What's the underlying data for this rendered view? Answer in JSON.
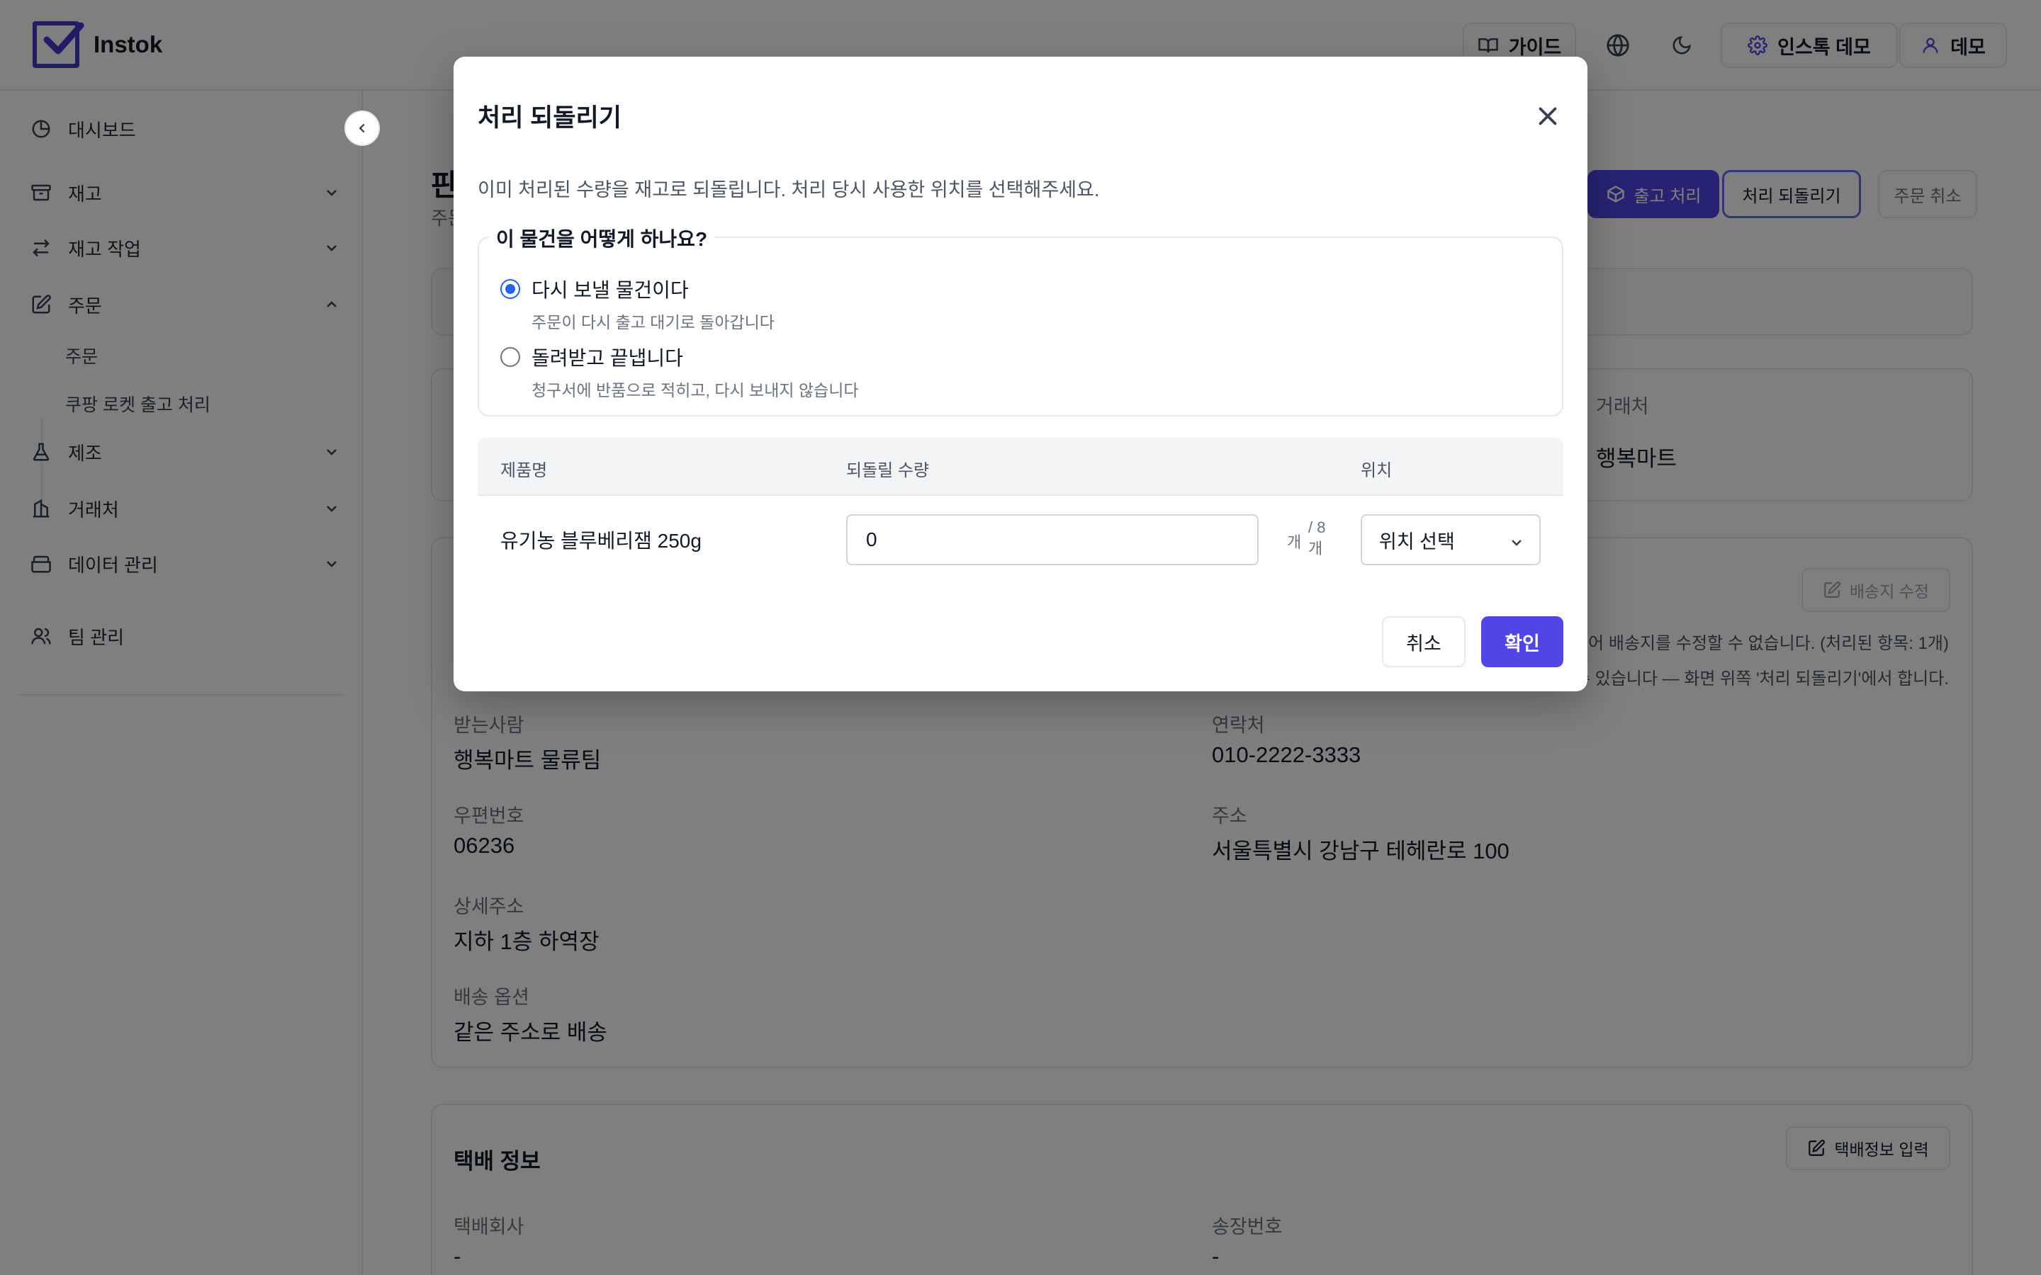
{
  "app": {
    "name": "Instok"
  },
  "topbar": {
    "guide_label": "가이드",
    "workspace_label": "인스톡 데모",
    "user_label": "데모"
  },
  "sidebar": {
    "items": [
      {
        "label": "대시보드"
      },
      {
        "label": "재고"
      },
      {
        "label": "재고 작업"
      },
      {
        "label": "주문"
      },
      {
        "label": "제조"
      },
      {
        "label": "거래처"
      },
      {
        "label": "데이터 관리"
      },
      {
        "label": "팀 관리"
      }
    ],
    "order_subitems": [
      {
        "label": "주문"
      },
      {
        "label": "쿠팡 로켓 출고 처리"
      }
    ]
  },
  "page": {
    "title_fragment": "판",
    "subtitle_fragment": "주문",
    "actions": {
      "ship_label": "출고 처리",
      "revert_label": "처리 되돌리기",
      "cancel_order_label": "주문 취소"
    },
    "partner": {
      "label": "거래처",
      "value": "행복마트"
    },
    "shipping": {
      "edit_label": "배송지 수정",
      "note_line1": "이 있어 배송지를 수정할 수 없습니다. (처리된 항목: 1개)",
      "note_line2": "할 수 있습니다 — 화면 위쪽 '처리 되돌리기'에서 합니다.",
      "recipient_label": "받는사람",
      "recipient_value": "행복마트 물류팀",
      "phone_label": "연락처",
      "phone_value": "010-2222-3333",
      "zip_label": "우편번호",
      "zip_value": "06236",
      "address_label": "주소",
      "address_value": "서울특별시 강남구 테헤란로 100",
      "detail_label": "상세주소",
      "detail_value": "지하 1층 하역장",
      "option_label": "배송 옵션",
      "option_value": "같은 주소로 배송"
    },
    "courier": {
      "title": "택배 정보",
      "input_label": "택배정보 입력",
      "company_label": "택배회사",
      "company_value": "-",
      "tracking_label": "송장번호",
      "tracking_value": "-"
    }
  },
  "modal": {
    "title": "처리 되돌리기",
    "description": "이미 처리된 수량을 재고로 되돌립니다. 처리 당시 사용한 위치를 선택해주세요.",
    "question": "이 물건을 어떻게 하나요?",
    "options": [
      {
        "label": "다시 보낼 물건이다",
        "sub": "주문이 다시 출고 대기로 돌아갑니다",
        "selected": true
      },
      {
        "label": "돌려받고 끝냅니다",
        "sub": "청구서에 반품으로 적히고, 다시 보내지 않습니다",
        "selected": false
      }
    ],
    "table": {
      "headers": {
        "product": "제품명",
        "qty": "되돌릴 수량",
        "location": "위치"
      },
      "row": {
        "product": "유기농 블루베리잼 250g",
        "qty_value": "0",
        "unit": "개",
        "max_line1": "/ 8",
        "max_line2": "개",
        "location_placeholder": "위치 선택"
      }
    },
    "cancel_label": "취소",
    "confirm_label": "확인"
  },
  "colors": {
    "primary": "#4f46e5",
    "radio_selected": "#2563eb",
    "overlay": "rgba(0,0,0,0.5)"
  }
}
